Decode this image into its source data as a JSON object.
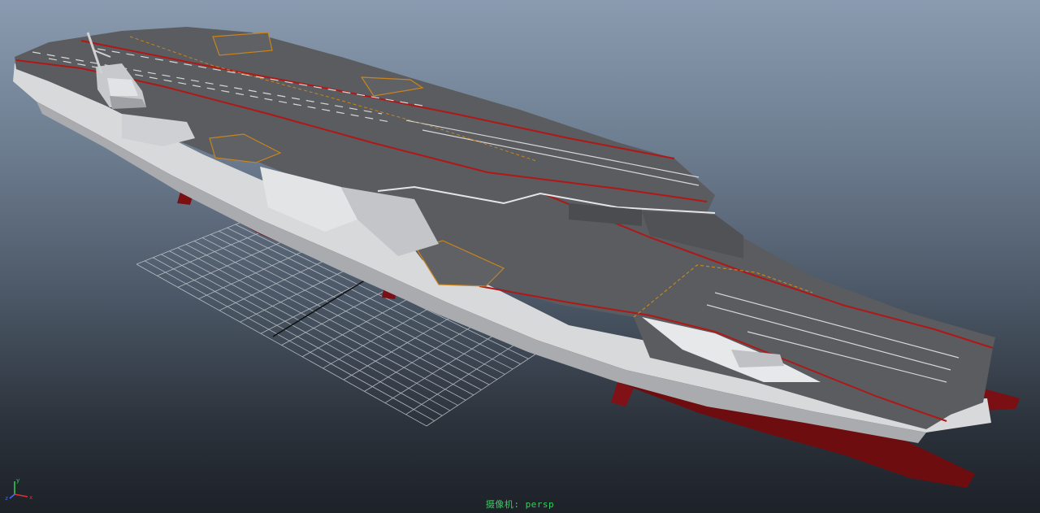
{
  "viewport": {
    "camera_prefix": "摄像机",
    "camera_name": "persp",
    "camera_separator": ": "
  },
  "axis_gizmo": {
    "x_label": "x",
    "y_label": "y",
    "z_label": "z",
    "colors": {
      "x": "#e03030",
      "y": "#30d050",
      "z": "#3a6cff"
    }
  },
  "scene_objects": {
    "model": "aircraft-carrier",
    "colors": {
      "deck": "#5a5c5f",
      "hull_side": "#d8d9db",
      "hull_shadow": "#a9abae",
      "waterline": "#6e0d10",
      "deck_edge_line": "#b01818",
      "deck_marking": "#d7d7d7",
      "elevator_outline": "#c8841e",
      "ground_grid": "#c7cbd0"
    }
  }
}
